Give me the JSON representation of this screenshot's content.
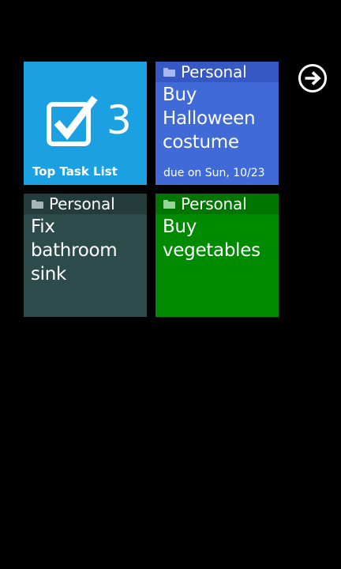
{
  "top_tile": {
    "count": "3",
    "label": "Top Task List",
    "color": "#1ba1e2",
    "icon": "checkbox-checked-icon"
  },
  "tasks": [
    {
      "category": "Personal",
      "title_lines": [
        "Buy",
        "Halloween",
        "costume"
      ],
      "due": "due on Sun, 10/23",
      "color": "#3f6ad8",
      "header_color": "#3558c4",
      "icon_color": "#a9b9f0"
    },
    {
      "category": "Personal",
      "title_lines": [
        "Fix",
        "bathroom",
        "sink"
      ],
      "due": "",
      "color": "#2d4b4a",
      "header_color": "#243c3b",
      "icon_color": "#a8b5b4"
    },
    {
      "category": "Personal",
      "title_lines": [
        "Buy",
        "vegetables"
      ],
      "due": "",
      "color": "#008a00",
      "header_color": "#007500",
      "icon_color": "#9bd49b"
    }
  ],
  "navigation": {
    "next_icon": "arrow-right-circle-icon"
  }
}
